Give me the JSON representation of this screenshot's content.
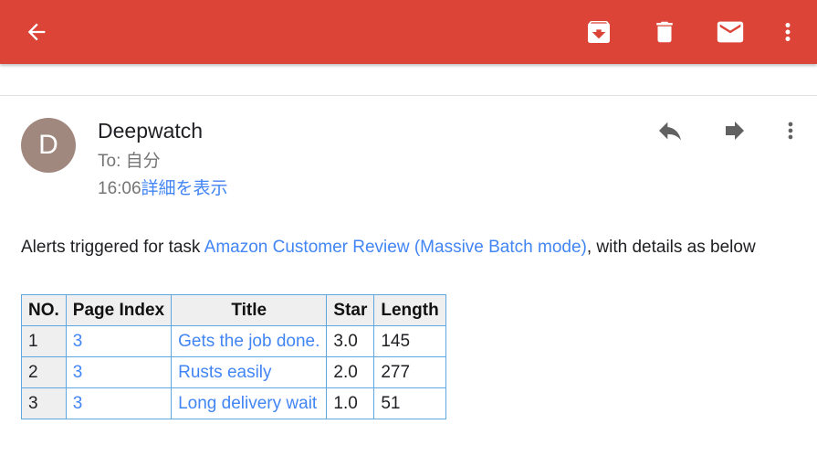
{
  "appbar": {
    "color": "#db4437",
    "icons": [
      "back-arrow-icon",
      "archive-icon",
      "delete-icon",
      "mark-unread-icon",
      "more-vert-icon"
    ]
  },
  "message": {
    "avatar_letter": "D",
    "avatar_color": "#a1887f",
    "sender": "Deepwatch",
    "to": "To: 自分",
    "time": "16:06",
    "details_link": "詳細を表示",
    "actions": [
      "reply-icon",
      "forward-icon",
      "more-vert-icon"
    ]
  },
  "body": {
    "intro": "Alerts triggered for task ",
    "task_link": "Amazon Customer Review (Massive Batch mode)",
    "suffix": ", with details as below"
  },
  "table": {
    "headers": [
      "NO.",
      "Page Index",
      "Title",
      "Star",
      "Length"
    ],
    "rows": [
      {
        "no": "1",
        "page": "3",
        "title": "Gets the job done.",
        "star": "3.0",
        "length": "145"
      },
      {
        "no": "2",
        "page": "3",
        "title": "Rusts easily",
        "star": "2.0",
        "length": "277"
      },
      {
        "no": "3",
        "page": "3",
        "title": "Long delivery wait",
        "star": "1.0",
        "length": "51"
      }
    ]
  }
}
